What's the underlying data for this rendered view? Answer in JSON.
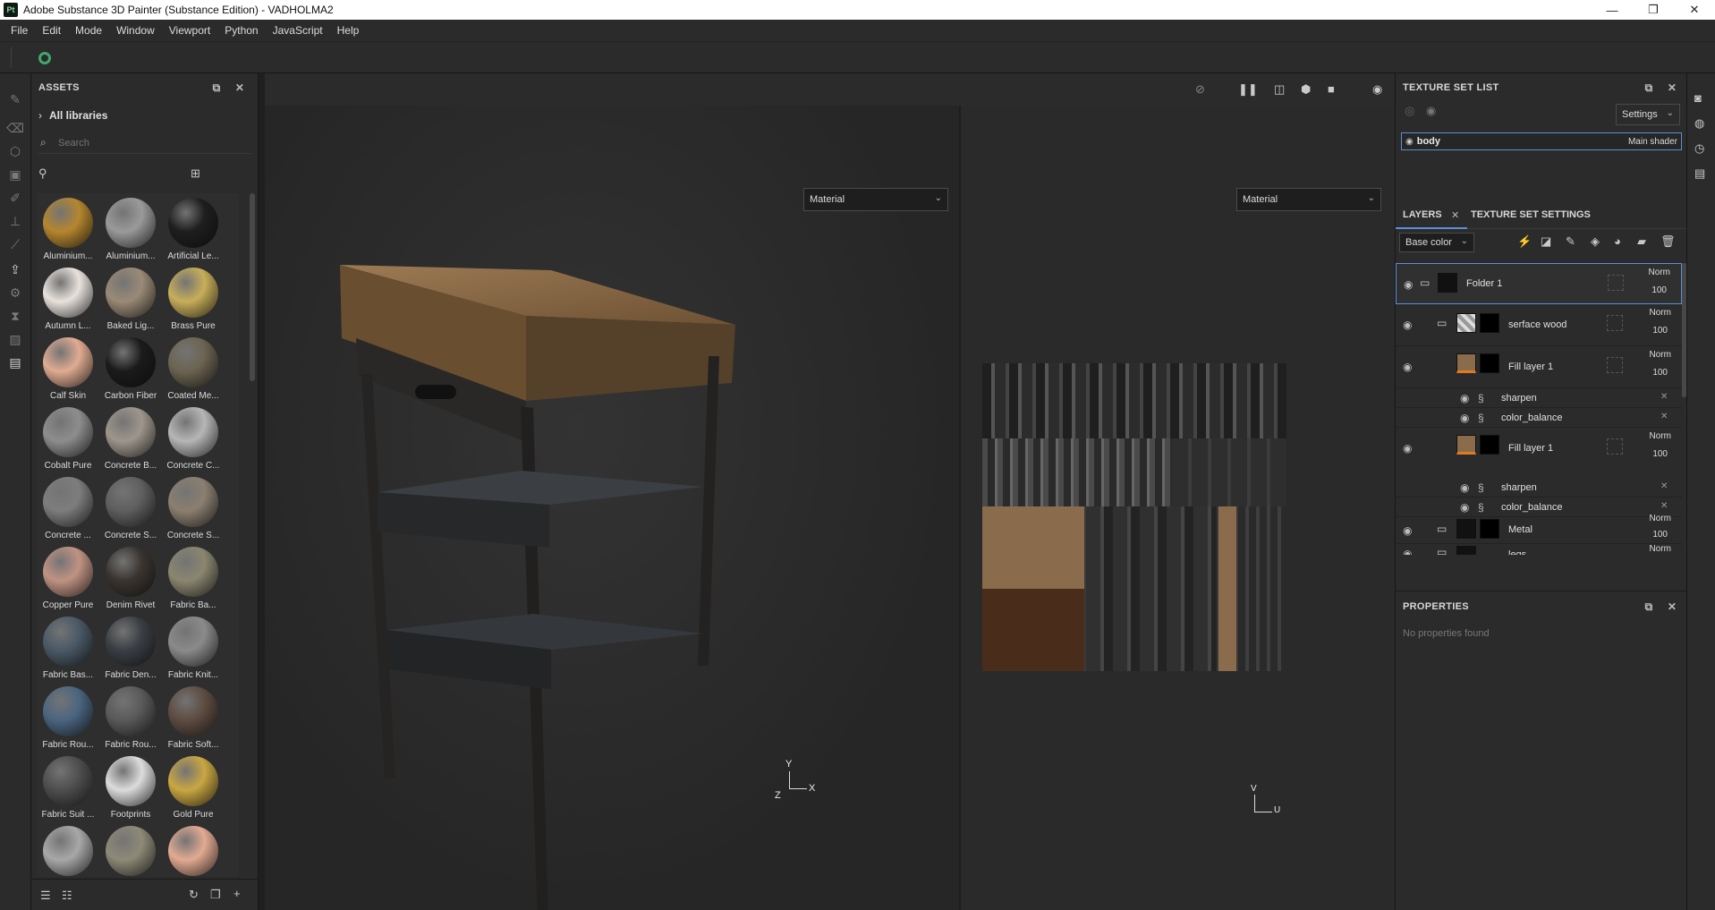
{
  "window": {
    "title": "Adobe Substance 3D Painter (Substance Edition) - VADHOLMA2",
    "logo": "Pt",
    "controls": [
      "—",
      "❐",
      "✕"
    ]
  },
  "menu": [
    "File",
    "Edit",
    "Mode",
    "Window",
    "Viewport",
    "Python",
    "JavaScript",
    "Help"
  ],
  "assets": {
    "title": "ASSETS",
    "library": "All libraries",
    "search_placeholder": "Search",
    "materials": [
      {
        "label": "Aluminium...",
        "color": "#b5862e"
      },
      {
        "label": "Aluminium...",
        "color": "#9a9a9a"
      },
      {
        "label": "Artificial Le...",
        "color": "#1e1e1e"
      },
      {
        "label": "Autumn L...",
        "color": "#e8e2dc"
      },
      {
        "label": "Baked Lig...",
        "color": "#9a8a76"
      },
      {
        "label": "Brass Pure",
        "color": "#c7ae5a"
      },
      {
        "label": "Calf Skin",
        "color": "#e0ab92"
      },
      {
        "label": "Carbon Fiber",
        "color": "#1b1b1b"
      },
      {
        "label": "Coated Me...",
        "color": "#6c6452"
      },
      {
        "label": "Cobalt Pure",
        "color": "#8d8d8d"
      },
      {
        "label": "Concrete B...",
        "color": "#9e968c"
      },
      {
        "label": "Concrete C...",
        "color": "#b6b6b6"
      },
      {
        "label": "Concrete ...",
        "color": "#7d7d7d"
      },
      {
        "label": "Concrete S...",
        "color": "#5f5f5f"
      },
      {
        "label": "Concrete S...",
        "color": "#8b7f70"
      },
      {
        "label": "Copper Pure",
        "color": "#c09383"
      },
      {
        "label": "Denim Rivet",
        "color": "#3a3430"
      },
      {
        "label": "Fabric Ba...",
        "color": "#8a8670"
      },
      {
        "label": "Fabric Bas...",
        "color": "#4a5966"
      },
      {
        "label": "Fabric Den...",
        "color": "#3a3e44"
      },
      {
        "label": "Fabric Knit...",
        "color": "#8a8a8a"
      },
      {
        "label": "Fabric Rou...",
        "color": "#4b6580"
      },
      {
        "label": "Fabric Rou...",
        "color": "#5a5a5a"
      },
      {
        "label": "Fabric Soft...",
        "color": "#5e4c42"
      },
      {
        "label": "Fabric Suit ...",
        "color": "#4e4e4e"
      },
      {
        "label": "Footprints",
        "color": "#dcdcdc"
      },
      {
        "label": "Gold Pure",
        "color": "#c9a742"
      },
      {
        "label": "",
        "color": "#a8a8a8"
      },
      {
        "label": "",
        "color": "#8e8a78"
      },
      {
        "label": "",
        "color": "#e2aa92"
      }
    ]
  },
  "viewport": {
    "left_mode": "Material",
    "right_mode": "Material",
    "axis_3d": {
      "x": "X",
      "y": "Y",
      "z": "Z"
    },
    "axis_2d": {
      "u": "U",
      "v": "V"
    }
  },
  "texture_set_list": {
    "title": "TEXTURE SET LIST",
    "settings": "Settings",
    "set_name": "body",
    "shader": "Main shader"
  },
  "layers_panel": {
    "tab_layers": "LAYERS",
    "tab_settings": "TEXTURE SET SETTINGS",
    "channel": "Base color",
    "layers": [
      {
        "name": "Folder 1",
        "blend": "Norm",
        "opacity": "100"
      },
      {
        "name": "serface wood",
        "blend": "Norm",
        "opacity": "100"
      },
      {
        "name": "Fill layer 1",
        "blend": "Norm",
        "opacity": "100"
      },
      {
        "name": "sharpen"
      },
      {
        "name": "color_balance"
      },
      {
        "name": "Fill layer 1",
        "blend": "Norm",
        "opacity": "100"
      },
      {
        "name": "sharpen"
      },
      {
        "name": "color_balance"
      },
      {
        "name": "Metal",
        "blend": "Norm",
        "opacity": "100"
      },
      {
        "name": "legs",
        "blend": "Norm"
      }
    ]
  },
  "properties": {
    "title": "PROPERTIES",
    "empty_text": "No properties found"
  }
}
